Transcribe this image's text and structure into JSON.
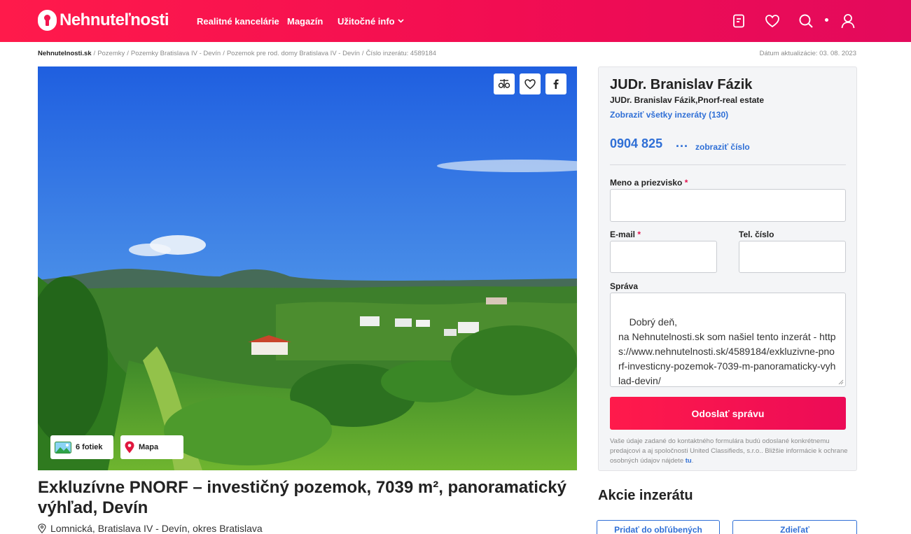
{
  "header": {
    "logo_text": "Nehnuteľnosti",
    "nav": [
      "Realitné kancelárie",
      "Magazín",
      "Užitočné info"
    ],
    "icons": [
      "document-icon",
      "heart-icon",
      "search-icon",
      "user-icon"
    ],
    "brand_color": "#f2154f"
  },
  "breadcrumb": {
    "items": [
      "Nehnutelnosti.sk",
      "Pozemky",
      "Pozemky Bratislava IV - Devín",
      "Pozemok pre rod. domy Bratislava IV - Devín",
      "Číslo inzerátu: 4589184"
    ],
    "updated": "Dátum aktualizácie: 03. 08. 2023"
  },
  "photo": {
    "photos_label": "6 fotiek",
    "map_label": "Mapa",
    "actions": [
      "compare-icon",
      "heart-icon",
      "facebook-icon"
    ]
  },
  "listing": {
    "title": "Exkluzívne PNORF – investičný pozemok, 7039 m², panoramatický výhľad, Devín",
    "address": "Lomnická, Bratislava IV - Devín, okres Bratislava"
  },
  "contact": {
    "agent_name": "JUDr. Branislav Fázik",
    "company": "JUDr. Branislav Fázik,Pnorf-real estate",
    "all_ads": "Zobraziť všetky inzeráty (130)",
    "phone": "0904 825",
    "phone_dots": "...",
    "show_number": "zobraziť číslo",
    "form": {
      "name_label": "Meno a priezvisko",
      "email_label": "E-mail",
      "phone_label": "Tel. číslo",
      "message_label": "Správa",
      "required_mark": "*",
      "message_value": "Dobrý deň,\nna Nehnutelnosti.sk som našiel tento inzerát - https://www.nehnutelnosti.sk/4589184/exkluzivne-pnorf-investicny-pozemok-7039-m-panoramaticky-vyhlad-devin/",
      "send_label": "Odoslať správu"
    },
    "privacy_text": "Vaše údaje zadané do kontaktného formulára budú odoslané konkrétnemu predajcovi a aj spoločnosti United Classifieds, s.r.o.. Bližšie informácie k ochrane osobných údajov nájdete",
    "privacy_link": "tu",
    "privacy_end": "."
  },
  "actions": {
    "title": "Akcie inzerátu",
    "favorite_label": "Pridať do obľúbených",
    "share_label": "Zdieľať"
  }
}
